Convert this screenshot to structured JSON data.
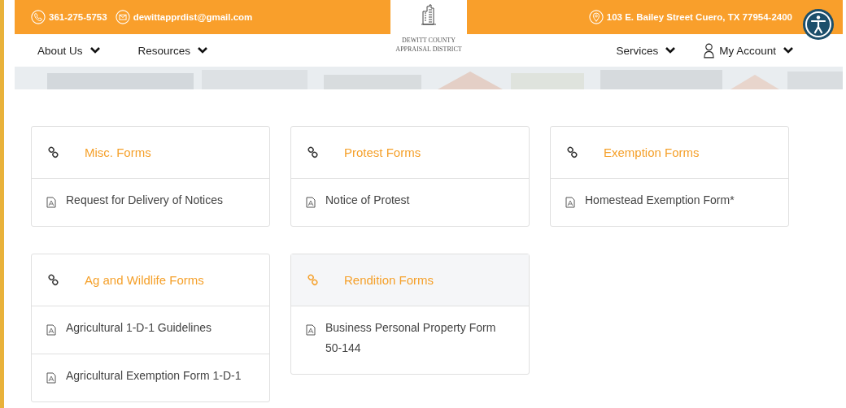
{
  "top_bar": {
    "phone": "361-275-5753",
    "email": "dewittapprdist@gmail.com",
    "address": "103 E. Bailey Street Cuero, TX 77954-2400"
  },
  "logo": {
    "line_1": "DEWITT COUNTY",
    "line_2": "APPRAISAL DISTRICT"
  },
  "nav": {
    "left": [
      {
        "label": "About Us"
      },
      {
        "label": "Resources"
      }
    ],
    "right": [
      {
        "label": "Services",
        "kind": "menu"
      },
      {
        "label": "My Account",
        "kind": "account"
      }
    ]
  },
  "cards": [
    {
      "title": "Misc. Forms",
      "highlighted": false,
      "items": [
        "Request for Delivery of Notices"
      ]
    },
    {
      "title": "Protest Forms",
      "highlighted": false,
      "items": [
        "Notice of Protest"
      ]
    },
    {
      "title": "Exemption Forms",
      "highlighted": false,
      "items": [
        "Homestead Exemption Form*"
      ]
    },
    {
      "title": "Ag and Wildlife Forms",
      "highlighted": false,
      "items": [
        "Agricultural 1-D-1 Guidelines",
        "Agricultural Exemption Form 1-D-1"
      ]
    },
    {
      "title": "Rendition Forms",
      "highlighted": true,
      "items": [
        "Business Personal Property Form 50-144"
      ]
    }
  ]
}
